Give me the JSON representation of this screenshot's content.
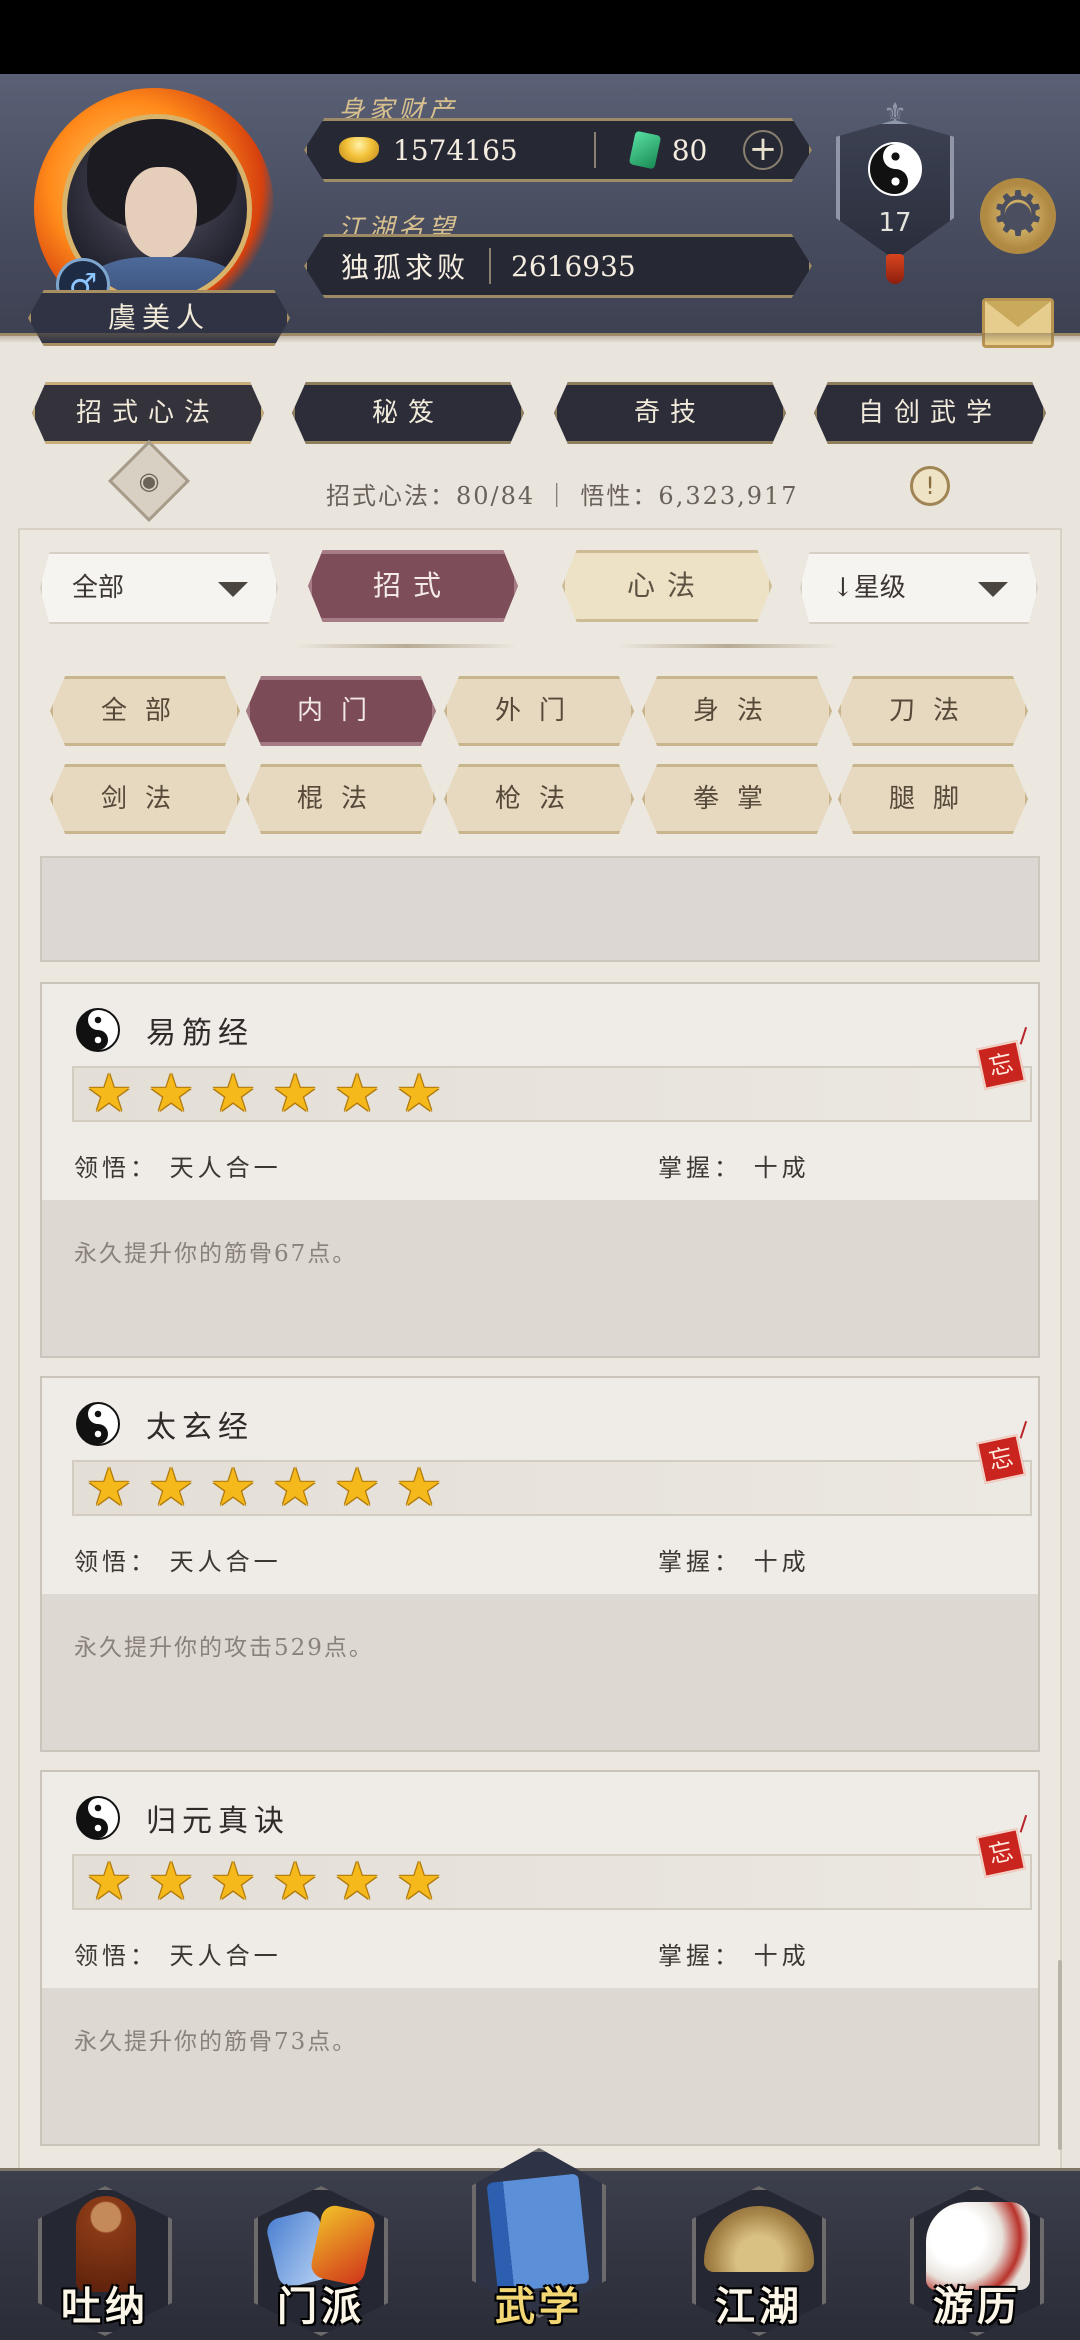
{
  "header": {
    "player_name": "虞美人",
    "gender_symbol": "♂",
    "wealth_label": "身家财产",
    "gold": "1574165",
    "jade": "80",
    "plus_symbol": "+",
    "fame_label": "江湖名望",
    "fame_title": "独孤求败",
    "fame_value": "2616935",
    "level": "17"
  },
  "top_tabs": [
    "招式心法",
    "秘笈",
    "奇技",
    "自创武学"
  ],
  "info": {
    "eye_symbol": "◉",
    "text": "招式心法：80/84 ｜ 悟性：6,323,917",
    "alert_symbol": "!"
  },
  "filters": {
    "category_select": "全部",
    "segments": [
      "招式",
      "心法"
    ],
    "sort_select": "↓星级"
  },
  "chips": [
    "全部",
    "内门",
    "外门",
    "身法",
    "刀法",
    "剑法",
    "棍法",
    "枪法",
    "拳掌",
    "腿脚"
  ],
  "skills": [
    {
      "name": "易筋经",
      "stars": 6,
      "comprehension": "领悟：  天人合一",
      "mastery": "掌握：  十成",
      "description": "永久提升你的筋骨67点。",
      "forget_label": "忘"
    },
    {
      "name": "太玄经",
      "stars": 6,
      "comprehension": "领悟：  天人合一",
      "mastery": "掌握：  十成",
      "description": "永久提升你的攻击529点。",
      "forget_label": "忘"
    },
    {
      "name": "归元真诀",
      "stars": 6,
      "comprehension": "领悟：  天人合一",
      "mastery": "掌握：  十成",
      "description": "永久提升你的筋骨73点。",
      "forget_label": "忘"
    }
  ],
  "star_glyph": "★",
  "bottom_nav": [
    "吐纳",
    "门派",
    "武学",
    "江湖",
    "游历"
  ],
  "colors": {
    "accent_active": "#7d4e5a",
    "header_bg": "#474c5f",
    "star": "#f6b91c",
    "forget_tag": "#c9241e"
  }
}
